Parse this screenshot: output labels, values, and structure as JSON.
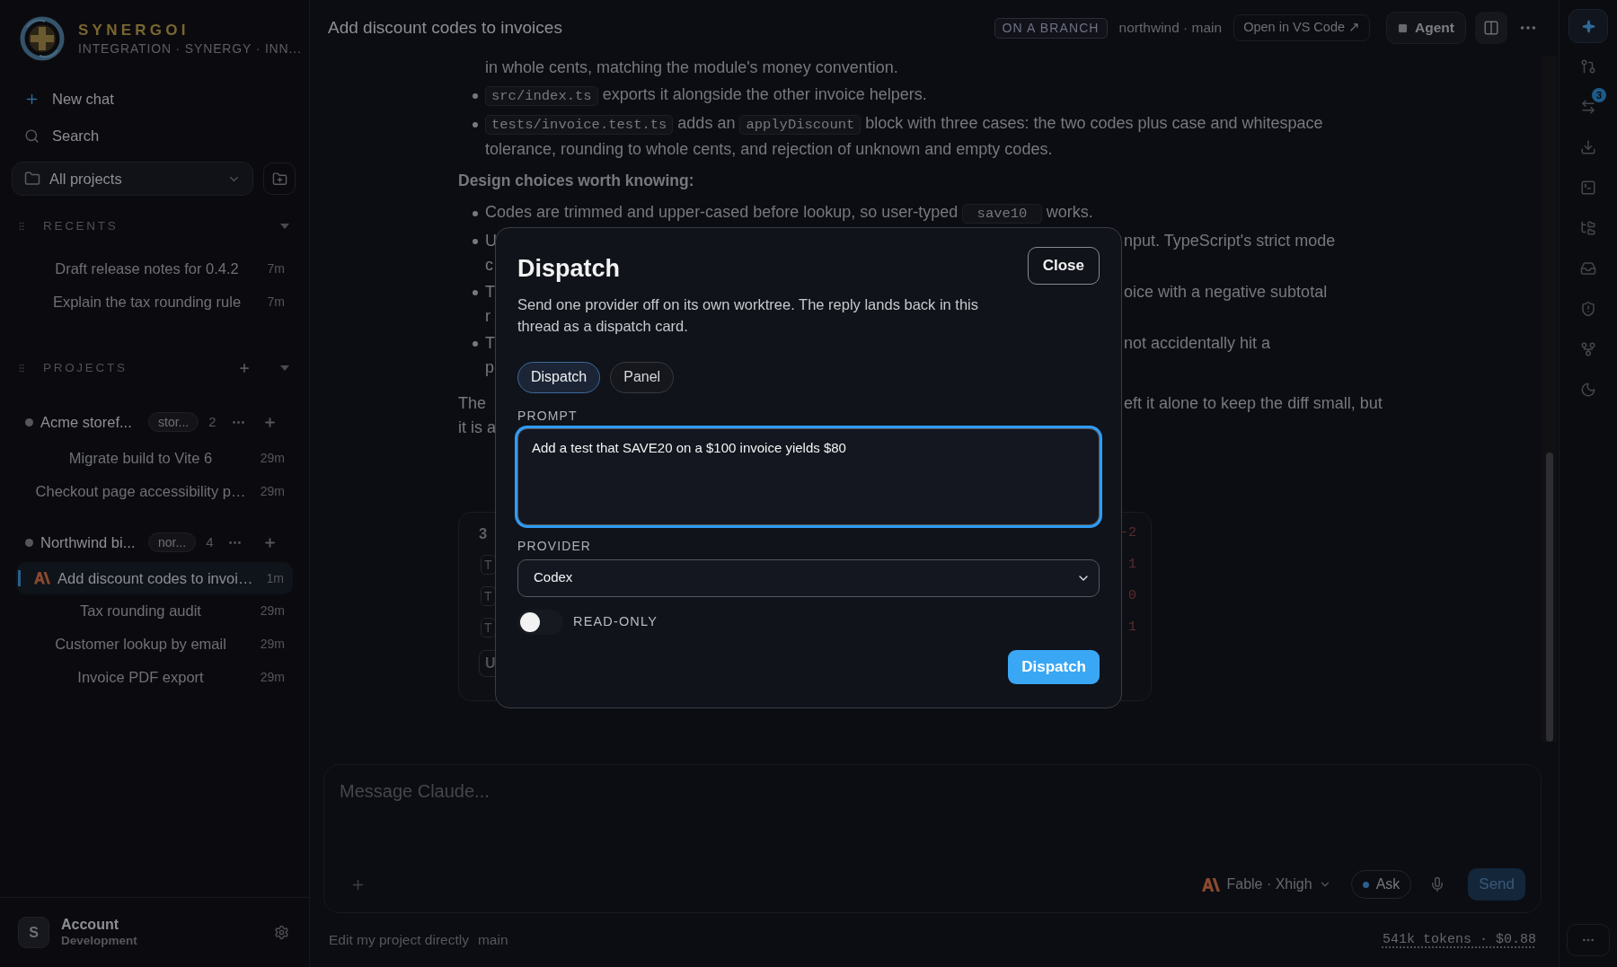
{
  "sidebar": {
    "brand": {
      "name": "SYNERGOI",
      "tagline": "INTEGRATION · SYNERGY · INN..."
    },
    "actions": [
      {
        "kind": "new",
        "label": "New chat"
      },
      {
        "kind": "search",
        "label": "Search"
      }
    ],
    "project_filter": "All projects",
    "recents": {
      "title": "RECENTS",
      "items": [
        {
          "title": "Draft release notes for 0.4.2",
          "age": "7m"
        },
        {
          "title": "Explain the tax rounding rule",
          "age": "7m"
        }
      ]
    },
    "projects": {
      "title": "PROJECTS",
      "items": [
        {
          "name": "Acme storef...",
          "tag": "stor...",
          "count": "2",
          "chats": [
            {
              "title": "Migrate build to Vite 6",
              "age": "29m",
              "selected": false
            },
            {
              "title": "Checkout page accessibility p…",
              "age": "29m",
              "selected": false
            }
          ]
        },
        {
          "name": "Northwind bi...",
          "tag": "nor...",
          "count": "4",
          "chats": [
            {
              "title": "Add discount codes to invoi…",
              "age": "1m",
              "selected": true
            },
            {
              "title": "Tax rounding audit",
              "age": "29m",
              "selected": false
            },
            {
              "title": "Customer lookup by email",
              "age": "29m",
              "selected": false
            },
            {
              "title": "Invoice PDF export",
              "age": "29m",
              "selected": false
            }
          ]
        }
      ]
    },
    "account": {
      "avatar": "S",
      "name": "Account",
      "subtitle": "Development"
    }
  },
  "header": {
    "title": "Add discount codes to invoices",
    "badge": "ON A BRANCH",
    "branch": "northwind · main",
    "open_button": "Open in VS Code ↗",
    "agent_button": "Agent"
  },
  "conversation": {
    "rows": [
      {
        "kind": "cont",
        "parts": [
          {
            "kind": "text",
            "text": "in whole cents, matching the module's money convention."
          }
        ]
      },
      {
        "kind": "bullet",
        "parts": [
          {
            "kind": "code",
            "text": "src/index.ts"
          },
          {
            "kind": "text",
            "text": " exports it alongside the other invoice helpers."
          }
        ]
      },
      {
        "kind": "bullet",
        "parts": [
          {
            "kind": "code",
            "text": "tests/invoice.test.ts"
          },
          {
            "kind": "text",
            "text": " adds an "
          },
          {
            "kind": "code",
            "text": "applyDiscount"
          },
          {
            "kind": "text",
            "text": " block with three cases: the two codes plus case and whitespace"
          }
        ]
      },
      {
        "kind": "cont",
        "parts": [
          {
            "kind": "text",
            "text": "tolerance, rounding to whole cents, and rejection of unknown and empty codes."
          }
        ]
      },
      {
        "kind": "heading",
        "parts": [
          {
            "kind": "text",
            "text": "Design choices worth knowing:"
          }
        ]
      },
      {
        "kind": "bullet",
        "parts": [
          {
            "kind": "text",
            "text": "Codes are trimmed and upper-cased before lookup, so user-typed "
          },
          {
            "kind": "code",
            "text": " save10 "
          },
          {
            "kind": "text",
            "text": " works."
          }
        ]
      },
      {
        "kind": "bullet",
        "parts": [
          {
            "kind": "text",
            "text": "U"
          }
        ],
        "right": "nput. TypeScript's strict mode"
      },
      {
        "kind": "cont",
        "parts": [
          {
            "kind": "text",
            "text": "c"
          }
        ]
      },
      {
        "kind": "bullet",
        "parts": [
          {
            "kind": "text",
            "text": "T"
          }
        ],
        "right": "oice with a negative subtotal"
      },
      {
        "kind": "cont",
        "parts": [
          {
            "kind": "text",
            "text": "r"
          }
        ]
      },
      {
        "kind": "bullet",
        "parts": [
          {
            "kind": "text",
            "text": "T"
          }
        ],
        "right": "not accidentally hit a"
      },
      {
        "kind": "cont",
        "parts": [
          {
            "kind": "text",
            "text": "p"
          }
        ]
      },
      {
        "kind": "para",
        "parts": [
          {
            "kind": "text",
            "text": "The"
          }
        ],
        "right": "eft it alone to keep the diff small, but"
      },
      {
        "kind": "cont-para",
        "parts": [
          {
            "kind": "text",
            "text": "it is a"
          }
        ]
      }
    ],
    "card": {
      "title": "3",
      "delta": "-2",
      "rows": [
        {
          "chip": "T",
          "delta": "1"
        },
        {
          "chip": "T",
          "delta": "0"
        },
        {
          "chip": "T",
          "delta": "1"
        }
      ],
      "button": "U"
    }
  },
  "dialog": {
    "title": "Dispatch",
    "close": "Close",
    "description": "Send one provider off on its own worktree. The reply lands back in this thread as a dispatch card.",
    "tabs": [
      {
        "label": "Dispatch",
        "selected": true
      },
      {
        "label": "Panel",
        "selected": false
      }
    ],
    "prompt": {
      "label": "PROMPT",
      "value": "Add a test that SAVE20 on a $100 invoice yields $80",
      "focused": true
    },
    "provider": {
      "label": "PROVIDER",
      "value": "Codex"
    },
    "read_only": {
      "label": "READ-ONLY",
      "on": false
    },
    "submit": "Dispatch"
  },
  "composer": {
    "placeholder": "Message Claude...",
    "model": "Fable · Xhigh",
    "mode": "Ask",
    "send": "Send"
  },
  "footer": {
    "mode": "Edit my project directly",
    "branch": "main",
    "usage": "541k tokens · $0.88"
  },
  "rail": [
    {
      "kind": "sparkle",
      "selected": true
    },
    {
      "kind": "branches",
      "selected": false
    },
    {
      "kind": "arrows",
      "selected": false,
      "badge": "3"
    },
    {
      "kind": "download",
      "selected": false
    },
    {
      "kind": "terminal",
      "selected": false
    },
    {
      "kind": "folders",
      "selected": false
    },
    {
      "kind": "inbox",
      "selected": false
    },
    {
      "kind": "shield",
      "selected": false
    },
    {
      "kind": "fork",
      "selected": false
    },
    {
      "kind": "moon",
      "selected": false
    }
  ]
}
